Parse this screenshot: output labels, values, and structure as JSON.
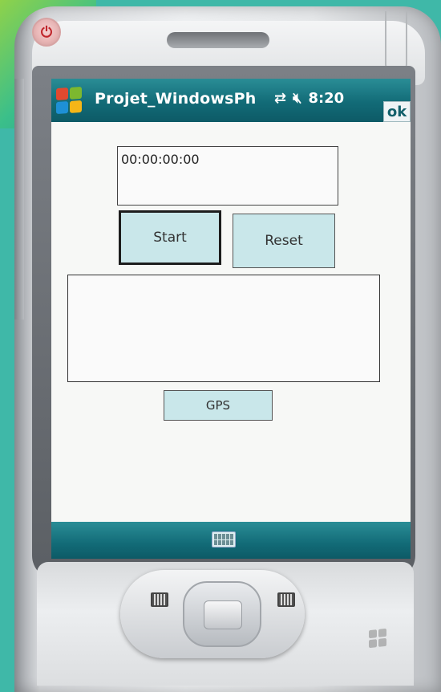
{
  "device": {
    "power_icon": "power-icon",
    "keyboard_icon": "keyboard-icon"
  },
  "title_bar": {
    "app_title": "Projet_WindowsPh",
    "time": "8:20",
    "ok_label": "ok",
    "icons": [
      "connectivity-icon",
      "volume-muted-icon"
    ]
  },
  "form": {
    "timer_value": "00:00:00:00",
    "start_label": "Start",
    "reset_label": "Reset",
    "output_value": "",
    "gps_label": "GPS"
  },
  "colors": {
    "title_bar": "#126b77",
    "button_bg": "#c9e7ea",
    "screen_bg": "#f7f8f6",
    "logo": [
      "#e2492f",
      "#7cb82f",
      "#1e90d6",
      "#f5b617"
    ]
  }
}
